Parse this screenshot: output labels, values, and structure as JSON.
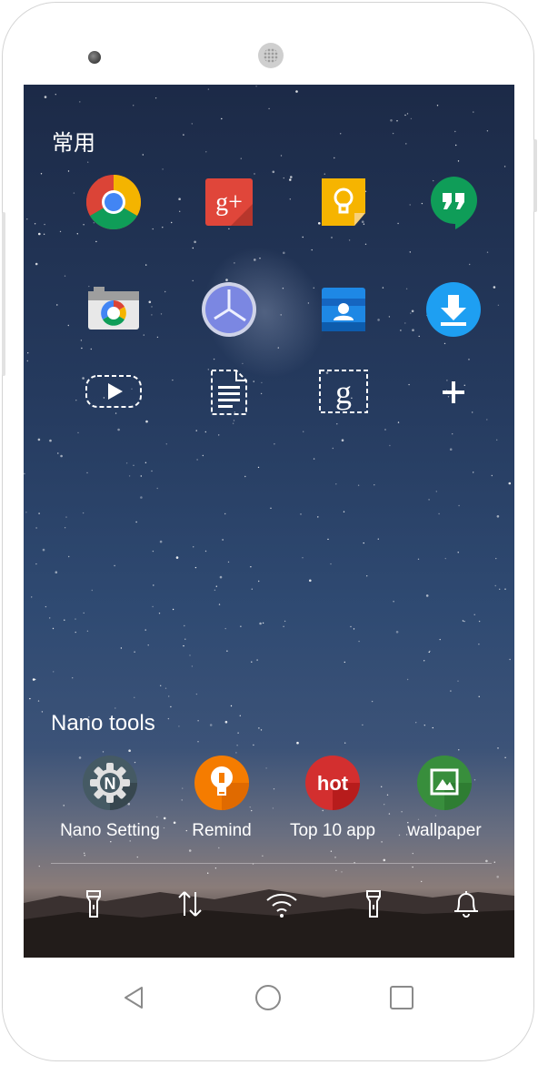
{
  "sections": {
    "common_title": "常用",
    "tools_title": "Nano tools"
  },
  "apps": [
    {
      "name": "chrome-icon"
    },
    {
      "name": "google-plus-icon",
      "text": "g+"
    },
    {
      "name": "keep-icon"
    },
    {
      "name": "hangouts-icon"
    },
    {
      "name": "camera-icon"
    },
    {
      "name": "clock-icon"
    },
    {
      "name": "contacts-icon"
    },
    {
      "name": "downloads-icon"
    },
    {
      "name": "play-movies-placeholder-icon"
    },
    {
      "name": "docs-placeholder-icon"
    },
    {
      "name": "google-search-placeholder-icon",
      "text": "g"
    },
    {
      "name": "add-icon"
    }
  ],
  "tools": [
    {
      "label": "Nano Setting",
      "letter": "N",
      "color": "#455a64"
    },
    {
      "label": "Remind",
      "color": "#f57c00"
    },
    {
      "label": "Top 10 app",
      "badge": "hot",
      "color": "#d32f2f"
    },
    {
      "label": "wallpaper",
      "color": "#388e3c"
    }
  ],
  "quick_settings": [
    "flashlight-icon",
    "data-transfer-icon",
    "wifi-icon",
    "flashlight-icon",
    "notification-bell-icon"
  ],
  "nav": [
    "back-icon",
    "home-icon",
    "recents-icon"
  ]
}
